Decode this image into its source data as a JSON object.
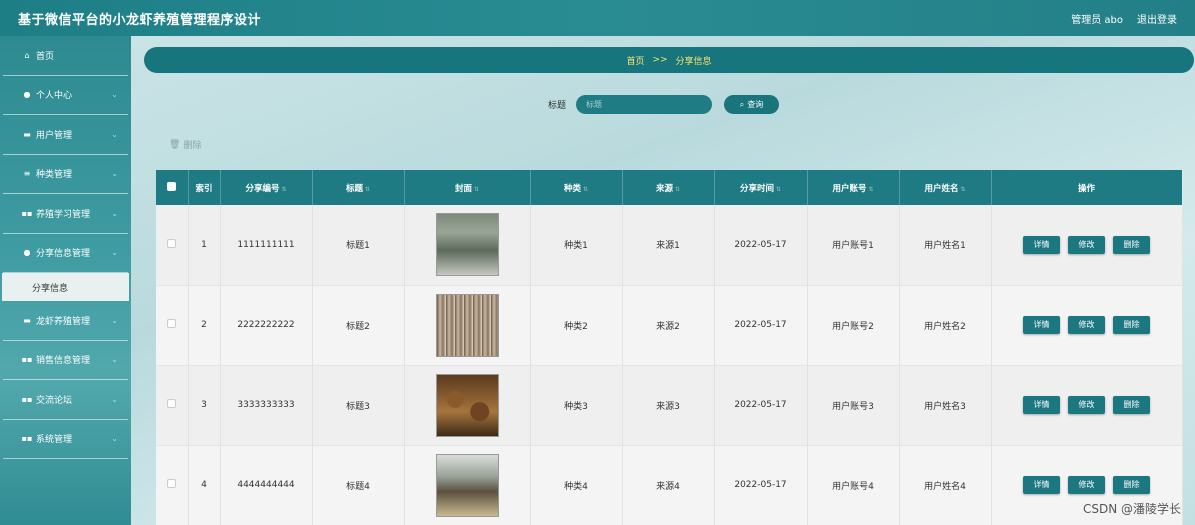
{
  "app": {
    "title": "基于微信平台的小龙虾养殖管理程序设计",
    "user_label": "管理员 abo",
    "logout_label": "退出登录"
  },
  "sidebar": {
    "items": [
      {
        "label": "首页",
        "icon": "home-icon",
        "glyph": "⌂"
      },
      {
        "label": "个人中心",
        "icon": "user-icon",
        "glyph": "●"
      },
      {
        "label": "用户管理",
        "icon": "users-icon",
        "glyph": "▬"
      },
      {
        "label": "种类管理",
        "icon": "sliders-icon",
        "glyph": "≡"
      },
      {
        "label": "养殖学习管理",
        "icon": "grid-icon",
        "glyph": "▪▪"
      },
      {
        "label": "分享信息管理",
        "icon": "pin-icon",
        "glyph": "●"
      },
      {
        "label": "龙虾养殖管理",
        "icon": "chat-icon",
        "glyph": "▬"
      },
      {
        "label": "销售信息管理",
        "icon": "grid-icon",
        "glyph": "▪▪"
      },
      {
        "label": "交流论坛",
        "icon": "grid-icon",
        "glyph": "▪▪"
      },
      {
        "label": "系统管理",
        "icon": "grid-icon",
        "glyph": "▪▪"
      }
    ],
    "active_sub": "分享信息"
  },
  "breadcrumb": {
    "home": "首页",
    "separator": ">>",
    "current": "分享信息"
  },
  "search": {
    "label": "标题",
    "placeholder": "标题",
    "button": "查询"
  },
  "toolbar": {
    "delete_label": "删除"
  },
  "table": {
    "headers": [
      "索引",
      "分享编号",
      "标题",
      "封面",
      "种类",
      "来源",
      "分享时间",
      "用户账号",
      "用户姓名",
      "操作"
    ],
    "rows": [
      {
        "index": "1",
        "code": "1111111111",
        "title": "标题1",
        "category": "种类1",
        "source": "来源1",
        "time": "2022-05-17",
        "account": "用户账号1",
        "name": "用户姓名1"
      },
      {
        "index": "2",
        "code": "2222222222",
        "title": "标题2",
        "category": "种类2",
        "source": "来源2",
        "time": "2022-05-17",
        "account": "用户账号2",
        "name": "用户姓名2"
      },
      {
        "index": "3",
        "code": "3333333333",
        "title": "标题3",
        "category": "种类3",
        "source": "来源3",
        "time": "2022-05-17",
        "account": "用户账号3",
        "name": "用户姓名3"
      },
      {
        "index": "4",
        "code": "4444444444",
        "title": "标题4",
        "category": "种类4",
        "source": "来源4",
        "time": "2022-05-17",
        "account": "用户账号4",
        "name": "用户姓名4"
      }
    ],
    "actions": {
      "detail": "详情",
      "edit": "修改",
      "delete": "删除"
    }
  },
  "watermark": "CSDN @潘陵学长"
}
